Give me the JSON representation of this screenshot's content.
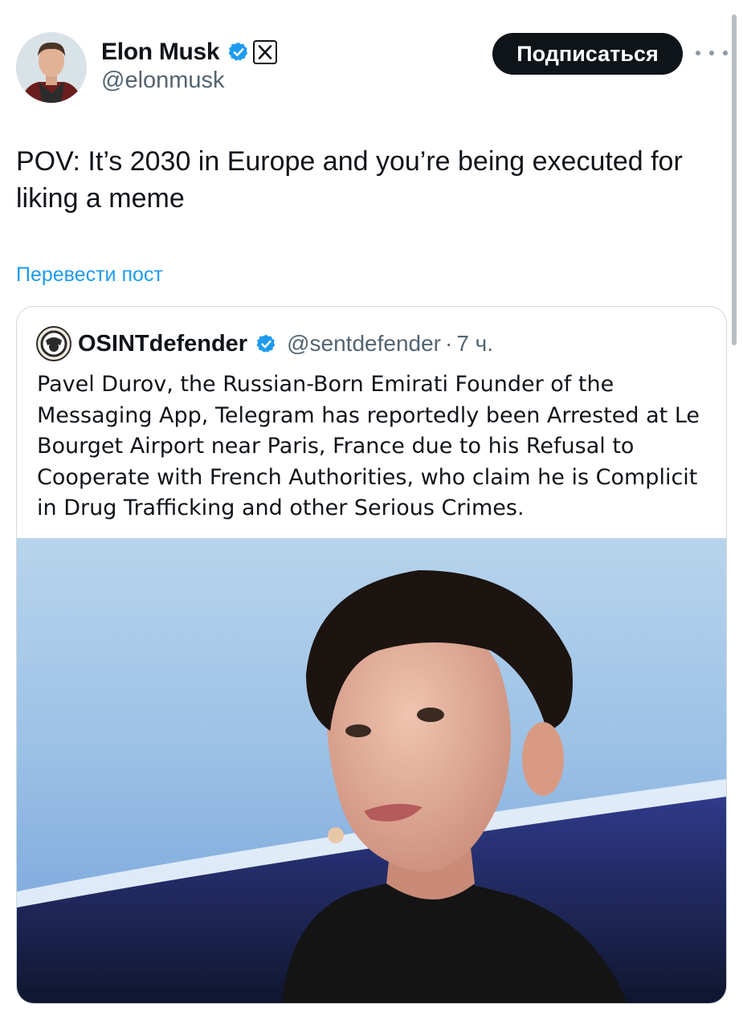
{
  "tweet": {
    "author_name": "Elon Musk",
    "handle": "@elonmusk",
    "follow_label": "Подписаться",
    "text": "POV: It’s 2030 in Europe and you’re being executed for liking a meme",
    "translate_label": "Перевести пост"
  },
  "quoted_tweet": {
    "author_name": "OSINTdefender",
    "handle": "@sentdefender",
    "separator": "·",
    "time": "7 ч.",
    "text": "Pavel Durov, the Russian-Born Emirati Founder of the Messaging App, Telegram has reportedly been Arrested at Le Bourget Airport near Paris, France due to his Refusal to Cooperate with French Authorities, who claim he is Complicit in Drug Trafficking and other Serious Crimes."
  },
  "icons": {
    "verified": "verified-badge-icon",
    "affiliate": "x-logo-icon",
    "more": "more-options-icon"
  },
  "colors": {
    "accent": "#1d9bf0",
    "text_primary": "#0f1419",
    "text_secondary": "#536471",
    "button_bg": "#0f1419",
    "border": "#cfd9de"
  }
}
